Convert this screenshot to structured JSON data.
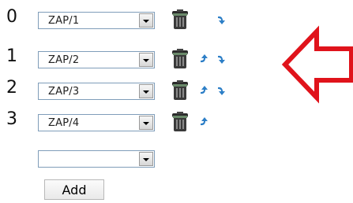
{
  "rows": [
    {
      "index": "0",
      "value": "ZAP/1",
      "has_up": false,
      "has_down": true
    },
    {
      "index": "1",
      "value": "ZAP/2",
      "has_up": true,
      "has_down": true
    },
    {
      "index": "2",
      "value": "ZAP/3",
      "has_up": true,
      "has_down": true
    },
    {
      "index": "3",
      "value": "ZAP/4",
      "has_up": true,
      "has_down": false
    }
  ],
  "empty_select": {
    "value": ""
  },
  "add_button": {
    "label": "Add"
  },
  "colors": {
    "arrow": "#e0131b",
    "icon_blue": "#2d7fc7",
    "trash_dark": "#2b2b2b"
  },
  "icons": {
    "trash": "trash-icon",
    "up": "arrow-up-icon",
    "down": "arrow-down-icon",
    "annotation": "left-arrow-icon"
  }
}
